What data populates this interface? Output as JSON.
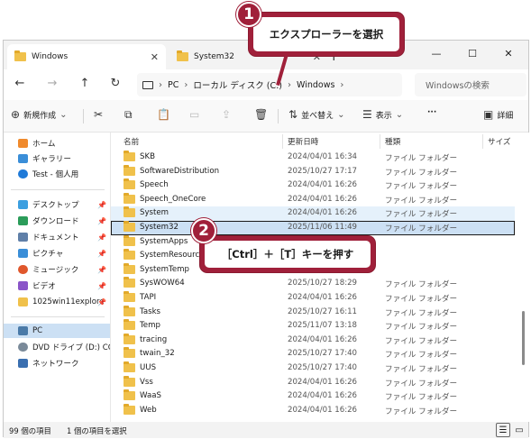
{
  "tabs": [
    {
      "label": "Windows"
    },
    {
      "label": "System32"
    }
  ],
  "nav": {
    "address": [
      "PC",
      "ローカル ディスク (C:)",
      "Windows"
    ],
    "search_placeholder": "Windowsの検索"
  },
  "toolbar": {
    "new_label": "新規作成",
    "sort_label": "並べ替え",
    "view_label": "表示",
    "more_label": "···",
    "details_label": "詳細"
  },
  "sidebar": {
    "group1": [
      {
        "label": "ホーム",
        "icon": "home-icon"
      },
      {
        "label": "ギャラリー",
        "icon": "gallery-icon"
      },
      {
        "label": "Test - 個人用",
        "icon": "onedrive-icon"
      }
    ],
    "group2": [
      {
        "label": "デスクトップ",
        "icon": "desktop-icon"
      },
      {
        "label": "ダウンロード",
        "icon": "download-icon"
      },
      {
        "label": "ドキュメント",
        "icon": "document-icon"
      },
      {
        "label": "ピクチャ",
        "icon": "picture-icon"
      },
      {
        "label": "ミュージック",
        "icon": "music-icon"
      },
      {
        "label": "ビデオ",
        "icon": "video-icon"
      },
      {
        "label": "1025win11explore",
        "icon": "folder-icon"
      }
    ],
    "group3": [
      {
        "label": "PC",
        "icon": "pc-icon"
      },
      {
        "label": "DVD ドライブ (D:) CCCO",
        "icon": "dvd-icon"
      },
      {
        "label": "ネットワーク",
        "icon": "network-icon"
      }
    ]
  },
  "columns": {
    "name": "名前",
    "date": "更新日時",
    "type": "種類",
    "size": "サイズ"
  },
  "rows": [
    {
      "name": "SKB",
      "date": "2024/04/01 16:34",
      "type": "ファイル フォルダー"
    },
    {
      "name": "SoftwareDistribution",
      "date": "2025/10/27 17:17",
      "type": "ファイル フォルダー"
    },
    {
      "name": "Speech",
      "date": "2024/04/01 16:26",
      "type": "ファイル フォルダー"
    },
    {
      "name": "Speech_OneCore",
      "date": "2024/04/01 16:26",
      "type": "ファイル フォルダー"
    },
    {
      "name": "System",
      "date": "2024/04/01 16:26",
      "type": "ファイル フォルダー"
    },
    {
      "name": "System32",
      "date": "2025/11/06 11:49",
      "type": "ファイル フォルダー"
    },
    {
      "name": "SystemApps",
      "date": "",
      "type": ""
    },
    {
      "name": "SystemResources",
      "date": "",
      "type": ""
    },
    {
      "name": "SystemTemp",
      "date": "",
      "type": ""
    },
    {
      "name": "SysWOW64",
      "date": "2025/10/27 18:29",
      "type": "ファイル フォルダー"
    },
    {
      "name": "TAPI",
      "date": "2024/04/01 16:26",
      "type": "ファイル フォルダー"
    },
    {
      "name": "Tasks",
      "date": "2025/10/27 16:11",
      "type": "ファイル フォルダー"
    },
    {
      "name": "Temp",
      "date": "2025/11/07 13:18",
      "type": "ファイル フォルダー"
    },
    {
      "name": "tracing",
      "date": "2024/04/01 16:26",
      "type": "ファイル フォルダー"
    },
    {
      "name": "twain_32",
      "date": "2025/10/27 17:40",
      "type": "ファイル フォルダー"
    },
    {
      "name": "UUS",
      "date": "2025/10/27 17:40",
      "type": "ファイル フォルダー"
    },
    {
      "name": "Vss",
      "date": "2024/04/01 16:26",
      "type": "ファイル フォルダー"
    },
    {
      "name": "WaaS",
      "date": "2024/04/01 16:26",
      "type": "ファイル フォルダー"
    },
    {
      "name": "Web",
      "date": "2024/04/01 16:26",
      "type": "ファイル フォルダー"
    }
  ],
  "status": {
    "count": "99 個の項目",
    "selected": "1 個の項目を選択"
  },
  "callouts": {
    "one_number": "1",
    "one_text": "エクスプローラーを選択",
    "two_number": "2",
    "two_text": "［Ctrl］＋［T］キーを押す"
  },
  "colors": {
    "accent": "#a0203a",
    "selection": "#cce0f4",
    "folder": "#f0c14b"
  }
}
